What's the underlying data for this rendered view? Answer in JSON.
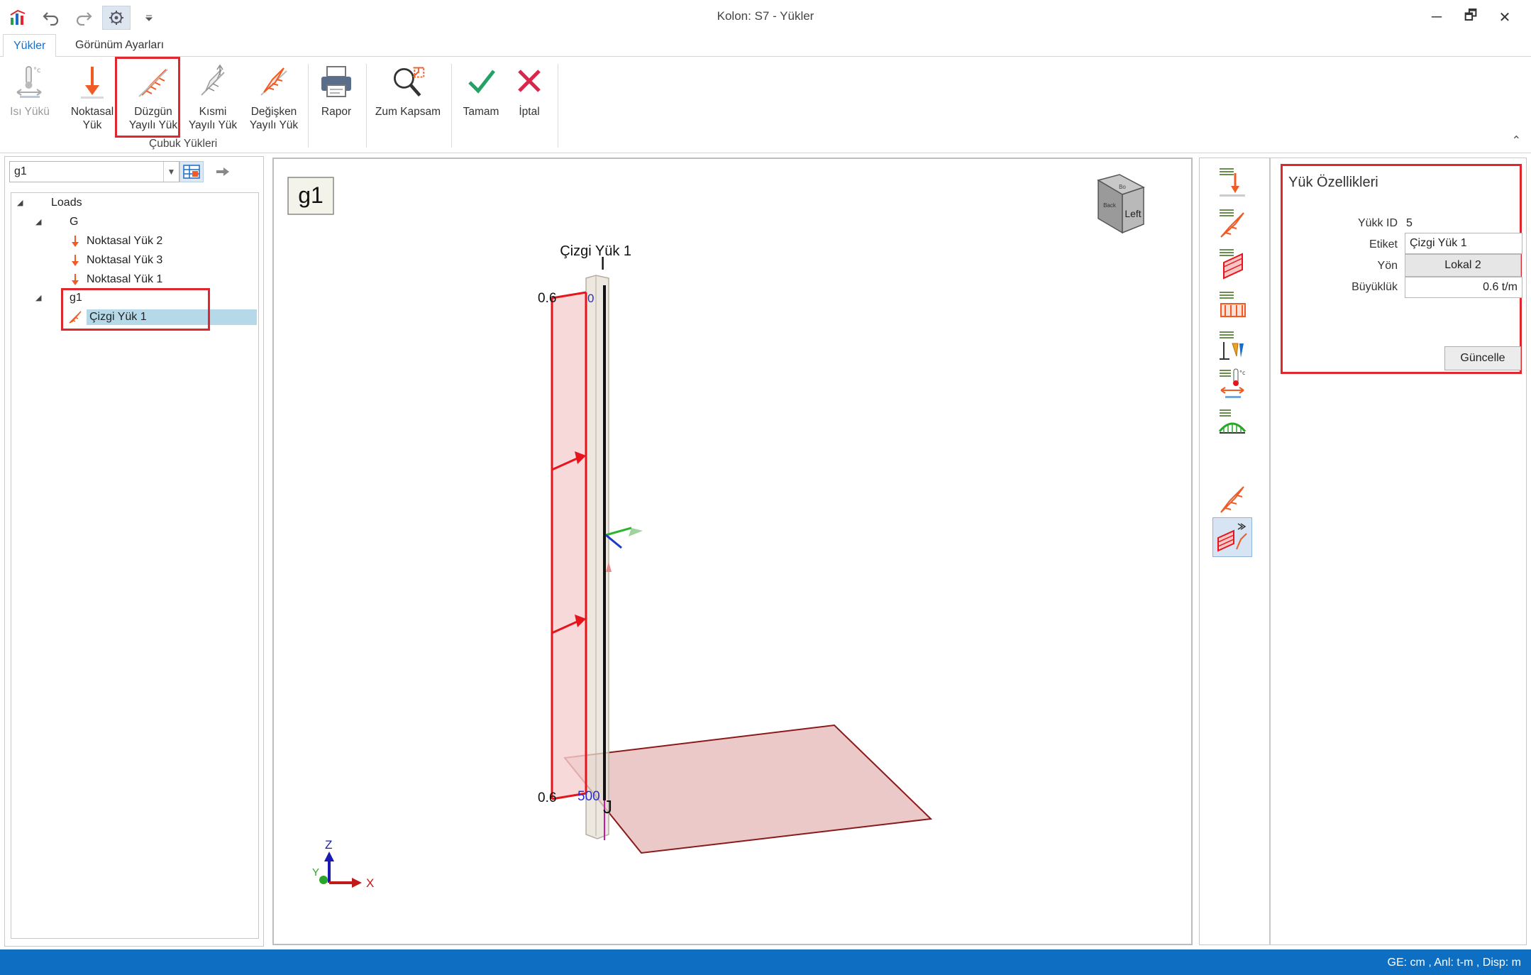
{
  "window": {
    "title": "Kolon: S7 - Yükler",
    "minimize": "─",
    "restore": "🗗",
    "close": "✕"
  },
  "tabs": [
    {
      "label": "Yükler"
    },
    {
      "label": "Görünüm Ayarları"
    }
  ],
  "ribbon": {
    "heat_load": "Isı Yükü",
    "point_load": [
      "Noktasal",
      "Yük"
    ],
    "uniform_load": [
      "Düzgün",
      "Yayılı Yük"
    ],
    "partial_load": [
      "Kısmi",
      "Yayılı Yük"
    ],
    "variable_load": [
      "Değişken",
      "Yayılı Yük"
    ],
    "report": "Rapor",
    "zoom_extents": "Zum Kapsam",
    "ok": "Tamam",
    "cancel": "İptal",
    "group_label": "Çubuk Yükleri",
    "collapse": "⌃"
  },
  "left_panel": {
    "combo_value": "g1",
    "tree": {
      "root": "Loads",
      "group_g": "G",
      "g_items": [
        "Noktasal Yük 2",
        "Noktasal Yük 3",
        "Noktasal Yük 1"
      ],
      "group_g1": "g1",
      "g1_items": [
        "Çizgi Yük 1"
      ]
    }
  },
  "viewport": {
    "case_label": "g1",
    "load_title": "Çizgi Yük 1",
    "top_value": "0.6",
    "bottom_value": "0.6",
    "start_pos": "0",
    "end_pos": "500",
    "node_i": "I",
    "node_j": "J",
    "cube_face": "Left",
    "cube_top": "Bo",
    "cube_back": "Back",
    "axis_x": "X",
    "axis_y": "Y",
    "axis_z": "Z"
  },
  "properties": {
    "title": "Yük Özellikleri",
    "id_label": "Yükk ID",
    "id_value": "5",
    "label_label": "Etiket",
    "label_value": "Çizgi Yük 1",
    "direction_label": "Yön",
    "direction_value": "Lokal 2",
    "magnitude_label": "Büyüklük",
    "magnitude_value": "0.6 t/m",
    "update_button": "Güncelle"
  },
  "statusbar": {
    "text": "GE: cm , Anl: t-m , Disp: m"
  },
  "colors": {
    "accent": "#1a6cc4",
    "highlight": "#e0262f",
    "load": "#f05a24",
    "status": "#0e6fc2"
  }
}
